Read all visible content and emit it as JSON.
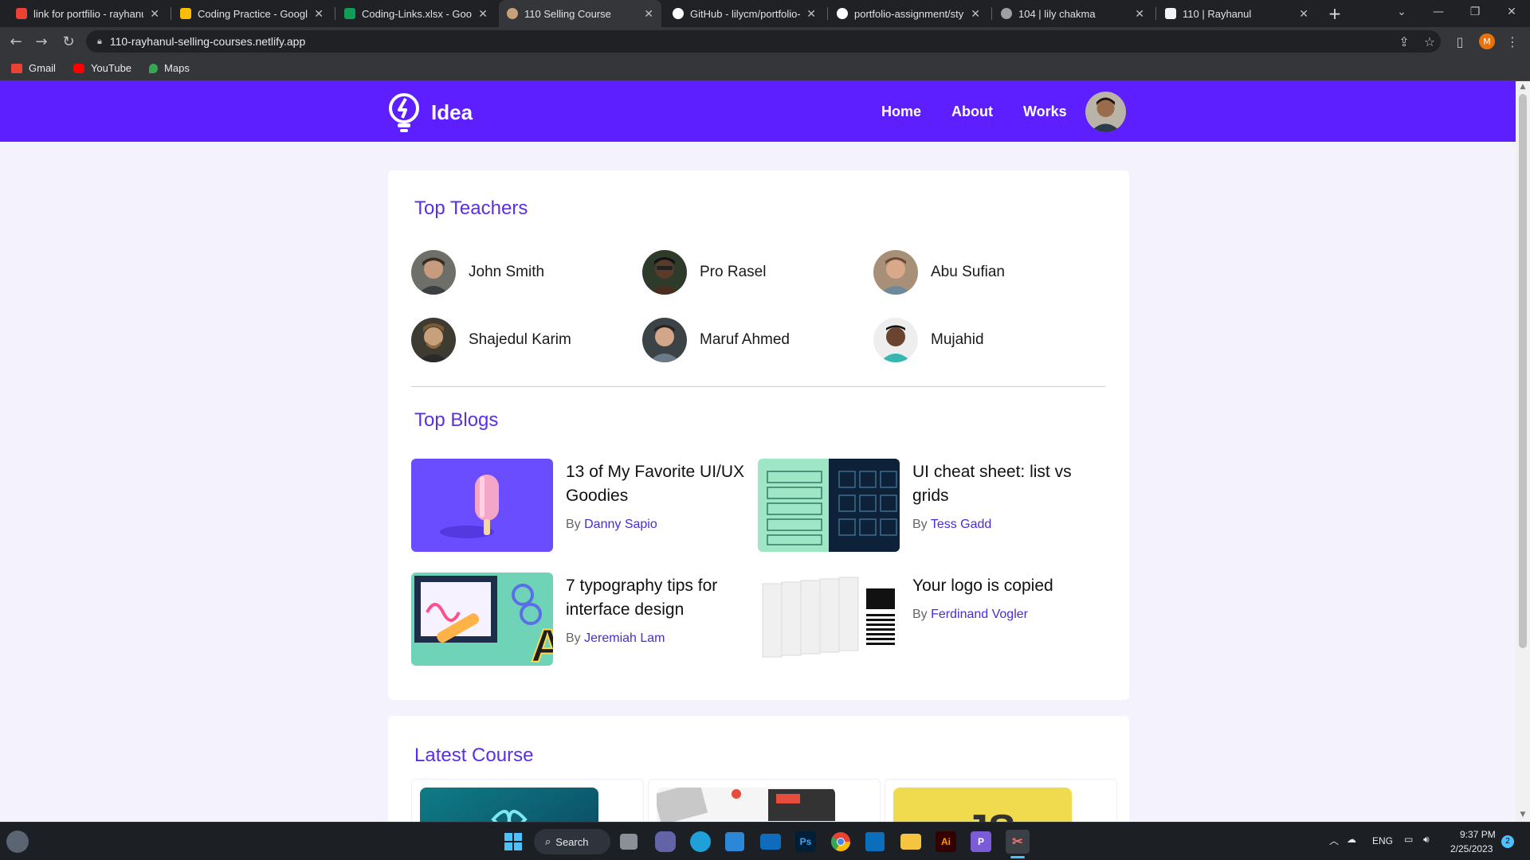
{
  "browser": {
    "tabs": [
      {
        "title": "link for portfilio - rayhanul",
        "favicon_color": "#ea4335",
        "active": false
      },
      {
        "title": "Coding Practice - Google D",
        "favicon_color": "#fbbc04",
        "active": false
      },
      {
        "title": "Coding-Links.xlsx - Google",
        "favicon_color": "#0f9d58",
        "active": false
      },
      {
        "title": "110 Selling Course",
        "favicon_color": "#c8a07a",
        "active": true
      },
      {
        "title": "GitHub - lilycm/portfolio-a",
        "favicon_color": "#ffffff",
        "active": false
      },
      {
        "title": "portfolio-assignment/style",
        "favicon_color": "#ffffff",
        "active": false
      },
      {
        "title": "104 | lily chakma",
        "favicon_color": "#9aa0a6",
        "active": false
      },
      {
        "title": "110 | Rayhanul",
        "favicon_color": "#f1f3f4",
        "active": false
      }
    ],
    "new_tab_label": "+",
    "url": "110-rayhanul-selling-courses.netlify.app",
    "profile_initial": "M",
    "bookmarks": [
      {
        "label": "Gmail",
        "color": "#ea4335"
      },
      {
        "label": "YouTube",
        "color": "#ff0000"
      },
      {
        "label": "Maps",
        "color": "#34a853"
      }
    ]
  },
  "site": {
    "logo_text": "Idea",
    "nav": [
      "Home",
      "About",
      "Works"
    ],
    "accent_color": "#5d1fff"
  },
  "teachers_section": {
    "title": "Top Teachers",
    "teachers": [
      {
        "name": "John Smith"
      },
      {
        "name": "Pro Rasel"
      },
      {
        "name": "Abu Sufian"
      },
      {
        "name": "Shajedul Karim"
      },
      {
        "name": "Maruf Ahmed"
      },
      {
        "name": "Mujahid"
      }
    ]
  },
  "blogs_section": {
    "title": "Top Blogs",
    "by_label": "By",
    "blogs": [
      {
        "title": "13 of My Favorite UI/UX Goodies",
        "author": "Danny Sapio"
      },
      {
        "title": "UI cheat sheet: list vs grids",
        "author": "Tess Gadd"
      },
      {
        "title": "7 typography tips for interface design",
        "author": "Jeremiah Lam"
      },
      {
        "title": "Your logo is copied",
        "author": "Ferdinand Vogler"
      }
    ]
  },
  "courses_section": {
    "title": "Latest Course",
    "thumb_text": [
      "JS"
    ]
  },
  "taskbar": {
    "search_label": "Search",
    "language": "ENG",
    "time": "9:37 PM",
    "date": "2/25/2023",
    "notification_count": "2",
    "apps": [
      "Ps",
      "Ai",
      "P"
    ]
  }
}
